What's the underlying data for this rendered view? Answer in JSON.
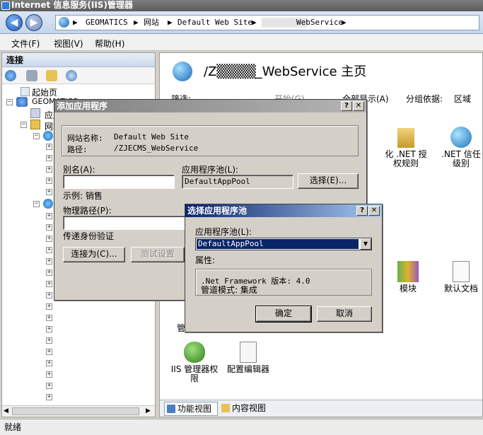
{
  "window": {
    "title": "Internet 信息服务(IIS)管理器"
  },
  "address": {
    "seg1": "GEOMATICS",
    "seg2": "网站",
    "seg3": "Default Web Site",
    "seg4": "WebService",
    "sep": "▶"
  },
  "menu": {
    "file": "文件(F)",
    "view": "视图(V)",
    "help": "帮助(H)"
  },
  "left": {
    "header": "连接",
    "tree": [
      "起始页",
      "GEOMATICS",
      "应用程序池",
      "网站"
    ]
  },
  "right": {
    "title": "/Z▒▒▒▒_WebService 主页",
    "filter_label": "筛选:",
    "start_label": "开始(G)",
    "show_all": "全部显示(A)",
    "group_label": "分组依据:",
    "group_value": "区域",
    "features": {
      "net_auth": "化 .NET 授权规则",
      "net_trust": ".NET 信任级别",
      "modules": "模块",
      "default_doc": "默认文档",
      "iis_mgr": "IIS 管理器权限",
      "config_editor": "配置编辑器",
      "manage": "管"
    },
    "tab_feature": "功能视图",
    "tab_content": "内容视图"
  },
  "status": {
    "text": "就绪"
  },
  "add_app": {
    "title": "添加应用程序",
    "site_label": "网站名称:",
    "site_value": "Default Web Site",
    "path_label": "路径:",
    "path_value": "/ZJECMS_WebService",
    "alias_label": "别名(A):",
    "alias_value": "",
    "pool_label": "应用程序池(L):",
    "pool_value": "DefaultAppPool",
    "select_button": "选择(E)...",
    "example": "示例: 销售",
    "phys_label": "物理路径(P):",
    "pass_auth": "传递身份验证",
    "connect_button": "连接为(C)...",
    "test_button": "测试设置(G)..."
  },
  "select_pool": {
    "title": "选择应用程序池",
    "pool_label": "应用程序池(L):",
    "pool_value": "DefaultAppPool",
    "props_label": "属性:",
    "net_framework": ".Net Framework 版本: 4.0",
    "pipeline": "管道模式: 集成",
    "ok_button": "确定",
    "cancel_button": "取消"
  }
}
